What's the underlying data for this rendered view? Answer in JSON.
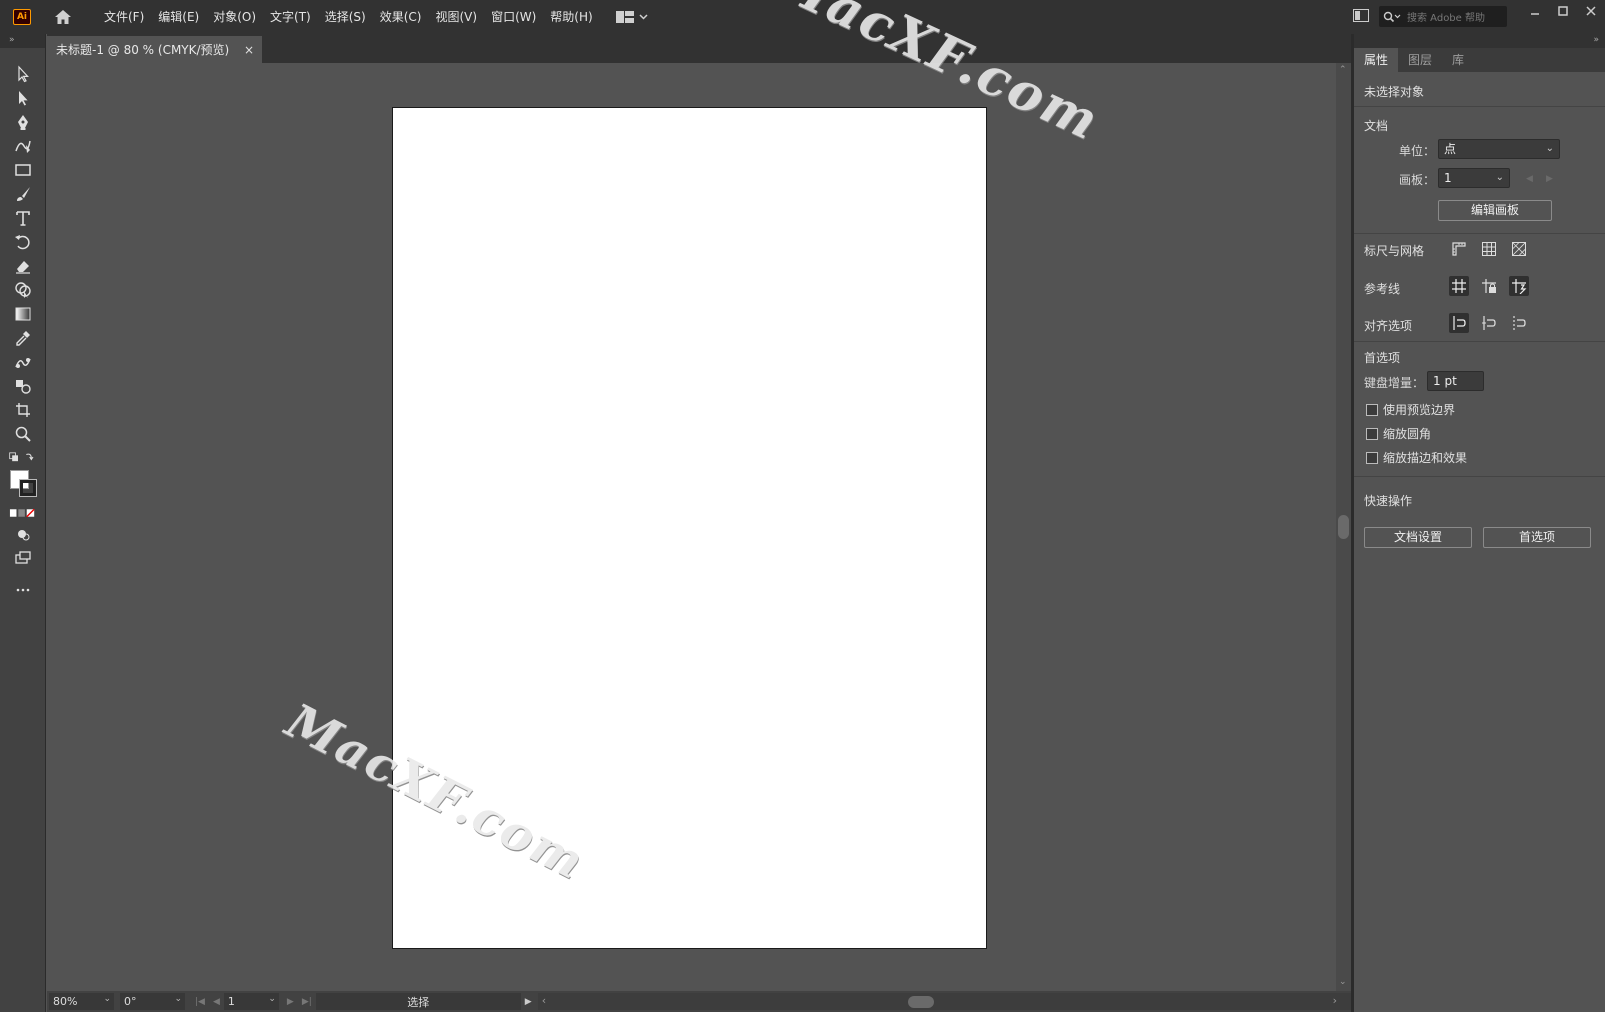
{
  "app": {
    "logo_text": "Ai",
    "menu": [
      "文件(F)",
      "编辑(E)",
      "对象(O)",
      "文字(T)",
      "选择(S)",
      "效果(C)",
      "视图(V)",
      "窗口(W)",
      "帮助(H)"
    ],
    "search_placeholder": "搜索 Adobe 帮助"
  },
  "document": {
    "tab_title": "未标题-1 @ 80 % (CMYK/预览)",
    "close_glyph": "×"
  },
  "statusbar": {
    "zoom": "80%",
    "rotation": "0°",
    "artboard_number": "1",
    "mode": "选择"
  },
  "panel": {
    "tabs": [
      "属性",
      "图层",
      "库"
    ],
    "no_selection": "未选择对象",
    "document_section": "文档",
    "unit_label": "单位：",
    "unit_value": "点",
    "artboard_label": "画板：",
    "artboard_value": "1",
    "edit_artboard_button": "编辑画板",
    "rulers_grids": "标尺与网格",
    "guides": "参考线",
    "snap_options": "对齐选项",
    "preferences_section": "首选项",
    "keyboard_increment_label": "键盘增量：",
    "keyboard_increment_value": "1 pt",
    "checkboxes": [
      "使用预览边界",
      "缩放圆角",
      "缩放描边和效果"
    ],
    "quick_actions": "快速操作",
    "doc_setup_button": "文档设置",
    "preferences_button": "首选项"
  },
  "watermark": "MacXF.com",
  "colors": {
    "menubar": "#323232",
    "workspace": "#535353",
    "artboard": "#ffffff",
    "logo_accent": "#ff9a00"
  }
}
